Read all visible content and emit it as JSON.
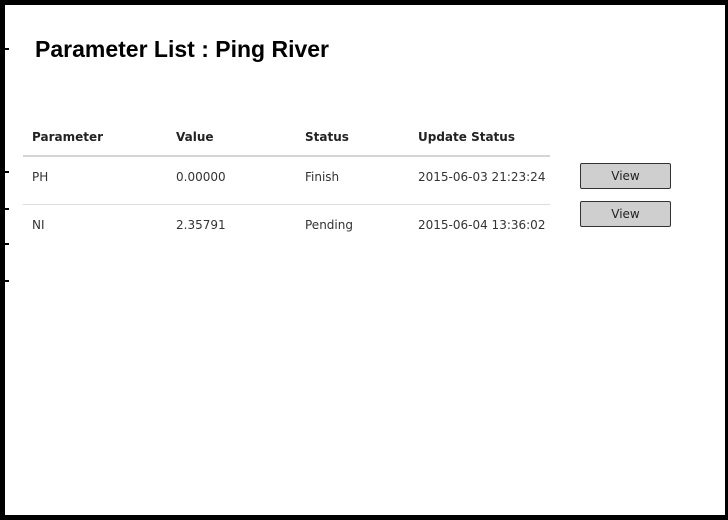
{
  "page": {
    "title": "Parameter List : Ping River"
  },
  "table": {
    "columns": [
      "Parameter",
      "Value",
      "Status",
      "Update Status"
    ],
    "rows": [
      {
        "parameter": "PH",
        "value": "0.00000",
        "status": "Finish",
        "update_status": "2015-06-03 21:23:24",
        "action_label": "View"
      },
      {
        "parameter": "NI",
        "value": "2.35791",
        "status": "Pending",
        "update_status": "2015-06-04 13:36:02",
        "action_label": "View"
      }
    ]
  },
  "colors": {
    "frame_border": "#000000",
    "button_fill": "#cfcfcf",
    "divider": "#d4d4d4"
  }
}
